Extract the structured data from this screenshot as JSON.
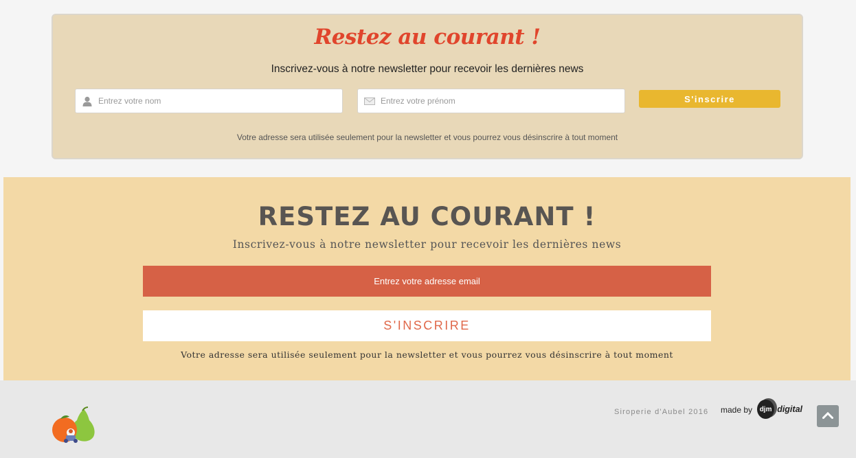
{
  "newsletter_v1": {
    "title": "Restez au courant !",
    "subtitle": "Inscrivez-vous à notre newsletter pour recevoir les dernières news",
    "name_placeholder": "Entrez votre nom",
    "firstname_placeholder": "Entrez votre prénom",
    "submit_label": "S'inscrire",
    "note": "Votre adresse sera utilisée seulement pour la newsletter et vous pourrez vous désinscrire à tout moment",
    "icons": {
      "name": "user-icon",
      "firstname": "envelope-icon"
    },
    "colors": {
      "background": "#e8d8b8",
      "title": "#e0452c",
      "button": "#e9b72f"
    }
  },
  "newsletter_v2": {
    "title": "RESTEZ AU COURANT !",
    "subtitle": "Inscrivez-vous à notre newsletter pour recevoir les dernières news",
    "email_placeholder": "Entrez votre adresse email",
    "submit_label": "S'INSCRIRE",
    "note": "Votre adresse sera utilisée seulement pour la newsletter et vous pourrez vous désinscrire à tout moment",
    "colors": {
      "background": "#f3d9a6",
      "email_field": "#d66146",
      "button_text": "#e0684a"
    }
  },
  "footer": {
    "copyright": "Siroperie d'Aubel 2016",
    "made_by": "made by",
    "agency_mark": "djm",
    "agency_word": "digital",
    "logo_icon": "fruit-logo-icon",
    "scroll_top_icon": "chevron-up-icon"
  }
}
